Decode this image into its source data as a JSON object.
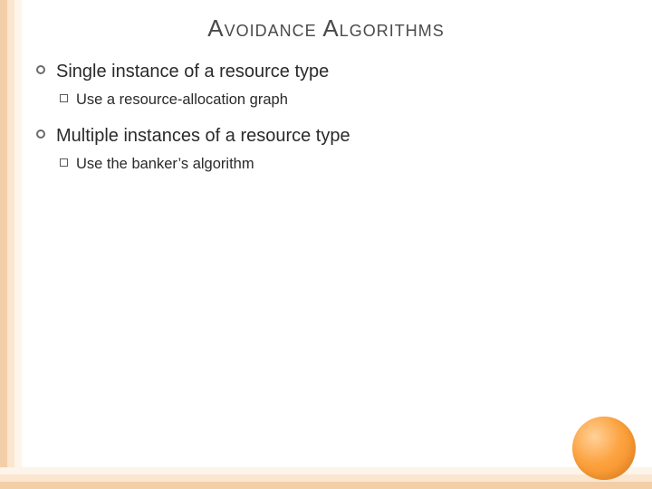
{
  "title": "Avoidance Algorithms",
  "sections": [
    {
      "heading": "Single instance of a resource type",
      "sub": "Use a resource-allocation graph"
    },
    {
      "heading": "Multiple instances of a resource type",
      "sub": "Use the banker’s algorithm"
    }
  ]
}
